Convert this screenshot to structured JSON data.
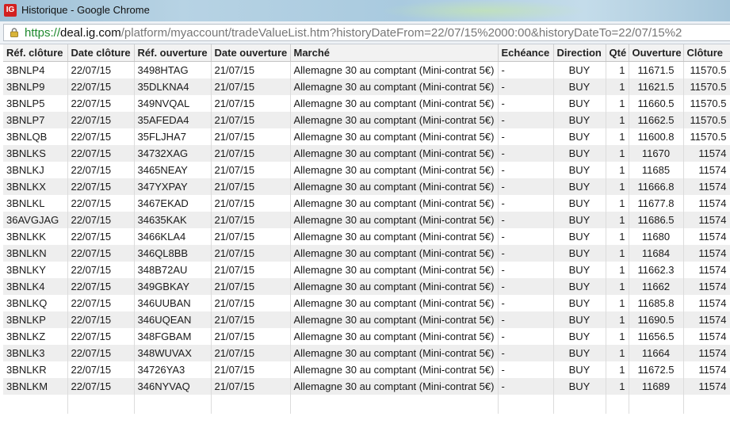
{
  "window": {
    "title": "Historique - Google Chrome",
    "app_icon_text": "IG"
  },
  "address": {
    "scheme": "https://",
    "host": "deal.ig.com",
    "path": "/platform/myaccount/tradeValueList.htm?historyDateFrom=22/07/15%2000:00&historyDateTo=22/07/15%2"
  },
  "table": {
    "headers": [
      "Réf. clôture",
      "Date clôture",
      "Réf. ouverture",
      "Date ouverture",
      "Marché",
      "Echéance",
      "Direction",
      "Qté",
      "Ouverture",
      "Clôture"
    ],
    "rows": [
      [
        "3BNLP4",
        "22/07/15",
        "3498HTAG",
        "21/07/15",
        "Allemagne 30 au comptant (Mini-contrat 5€)",
        "-",
        "BUY",
        "1",
        "11671.5",
        "11570.5"
      ],
      [
        "3BNLP9",
        "22/07/15",
        "35DLKNA4",
        "21/07/15",
        "Allemagne 30 au comptant (Mini-contrat 5€)",
        "-",
        "BUY",
        "1",
        "11621.5",
        "11570.5"
      ],
      [
        "3BNLP5",
        "22/07/15",
        "349NVQAL",
        "21/07/15",
        "Allemagne 30 au comptant (Mini-contrat 5€)",
        "-",
        "BUY",
        "1",
        "11660.5",
        "11570.5"
      ],
      [
        "3BNLP7",
        "22/07/15",
        "35AFEDA4",
        "21/07/15",
        "Allemagne 30 au comptant (Mini-contrat 5€)",
        "-",
        "BUY",
        "1",
        "11662.5",
        "11570.5"
      ],
      [
        "3BNLQB",
        "22/07/15",
        "35FLJHA7",
        "21/07/15",
        "Allemagne 30 au comptant (Mini-contrat 5€)",
        "-",
        "BUY",
        "1",
        "11600.8",
        "11570.5"
      ],
      [
        "3BNLKS",
        "22/07/15",
        "34732XAG",
        "21/07/15",
        "Allemagne 30 au comptant (Mini-contrat 5€)",
        "-",
        "BUY",
        "1",
        "11670",
        "11574"
      ],
      [
        "3BNLKJ",
        "22/07/15",
        "3465NEAY",
        "21/07/15",
        "Allemagne 30 au comptant (Mini-contrat 5€)",
        "-",
        "BUY",
        "1",
        "11685",
        "11574"
      ],
      [
        "3BNLKX",
        "22/07/15",
        "347YXPAY",
        "21/07/15",
        "Allemagne 30 au comptant (Mini-contrat 5€)",
        "-",
        "BUY",
        "1",
        "11666.8",
        "11574"
      ],
      [
        "3BNLKL",
        "22/07/15",
        "3467EKAD",
        "21/07/15",
        "Allemagne 30 au comptant (Mini-contrat 5€)",
        "-",
        "BUY",
        "1",
        "11677.8",
        "11574"
      ],
      [
        "36AVGJAG",
        "22/07/15",
        "34635KAK",
        "21/07/15",
        "Allemagne 30 au comptant (Mini-contrat 5€)",
        "-",
        "BUY",
        "1",
        "11686.5",
        "11574"
      ],
      [
        "3BNLKK",
        "22/07/15",
        "3466KLA4",
        "21/07/15",
        "Allemagne 30 au comptant (Mini-contrat 5€)",
        "-",
        "BUY",
        "1",
        "11680",
        "11574"
      ],
      [
        "3BNLKN",
        "22/07/15",
        "346QL8BB",
        "21/07/15",
        "Allemagne 30 au comptant (Mini-contrat 5€)",
        "-",
        "BUY",
        "1",
        "11684",
        "11574"
      ],
      [
        "3BNLKY",
        "22/07/15",
        "348B72AU",
        "21/07/15",
        "Allemagne 30 au comptant (Mini-contrat 5€)",
        "-",
        "BUY",
        "1",
        "11662.3",
        "11574"
      ],
      [
        "3BNLK4",
        "22/07/15",
        "349GBKAY",
        "21/07/15",
        "Allemagne 30 au comptant (Mini-contrat 5€)",
        "-",
        "BUY",
        "1",
        "11662",
        "11574"
      ],
      [
        "3BNLKQ",
        "22/07/15",
        "346UUBAN",
        "21/07/15",
        "Allemagne 30 au comptant (Mini-contrat 5€)",
        "-",
        "BUY",
        "1",
        "11685.8",
        "11574"
      ],
      [
        "3BNLKP",
        "22/07/15",
        "346UQEAN",
        "21/07/15",
        "Allemagne 30 au comptant (Mini-contrat 5€)",
        "-",
        "BUY",
        "1",
        "11690.5",
        "11574"
      ],
      [
        "3BNLKZ",
        "22/07/15",
        "348FGBAM",
        "21/07/15",
        "Allemagne 30 au comptant (Mini-contrat 5€)",
        "-",
        "BUY",
        "1",
        "11656.5",
        "11574"
      ],
      [
        "3BNLK3",
        "22/07/15",
        "348WUVAX",
        "21/07/15",
        "Allemagne 30 au comptant (Mini-contrat 5€)",
        "-",
        "BUY",
        "1",
        "11664",
        "11574"
      ],
      [
        "3BNLKR",
        "22/07/15",
        "34726YA3",
        "21/07/15",
        "Allemagne 30 au comptant (Mini-contrat 5€)",
        "-",
        "BUY",
        "1",
        "11672.5",
        "11574"
      ],
      [
        "3BNLKM",
        "22/07/15",
        "346NYVAQ",
        "21/07/15",
        "Allemagne 30 au comptant (Mini-contrat 5€)",
        "-",
        "BUY",
        "1",
        "11689",
        "11574"
      ]
    ]
  },
  "colors": {
    "url_scheme": "#1f8a2e",
    "row_alt": "#eeeeee",
    "app_icon": "#d22020"
  },
  "icons": {
    "app": "ig-app-icon",
    "lock": "lock-icon"
  }
}
